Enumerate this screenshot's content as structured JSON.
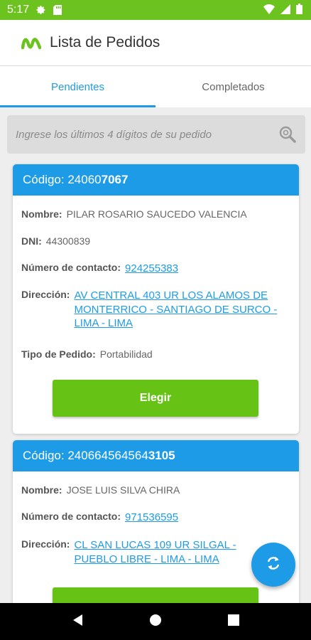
{
  "status_bar": {
    "time": "5:17"
  },
  "app_bar": {
    "title": "Lista de Pedidos"
  },
  "tabs": [
    {
      "label": "Pendientes"
    },
    {
      "label": "Completados"
    }
  ],
  "search": {
    "placeholder": "Ingrese los últimos 4 dígitos de su pedido"
  },
  "orders": [
    {
      "code_label": "Código:",
      "code_prefix": "24060",
      "code_suffix": "7067",
      "name_label": "Nombre:",
      "name": "PILAR ROSARIO SAUCEDO VALENCIA",
      "dni_label": "DNI:",
      "dni": "44300839",
      "contact_label": "Número de contacto:",
      "contact": "924255383",
      "address_label": "Dirección:",
      "address_lines": [
        "AV CENTRAL 403 UR LOS ALAMOS DE",
        "MONTERRICO - SANTIAGO DE SURCO -",
        "LIMA - LIMA"
      ],
      "type_label": "Tipo de Pedido:",
      "type": "Portabilidad",
      "button_label": "Elegir"
    },
    {
      "code_label": "Código:",
      "code_prefix": "240664564564",
      "code_suffix": "3105",
      "name_label": "Nombre:",
      "name": "JOSE LUIS SILVA CHIRA",
      "contact_label": "Número de contacto:",
      "contact": "971536595",
      "address_label": "Dirección:",
      "address_lines": [
        "CL SAN LUCAS 109 UR SILGAL -",
        "PUEBLO LIBRE - LIMA - LIMA"
      ]
    }
  ],
  "colors": {
    "status_bar": "#6cc21f",
    "accent_blue": "#1e9be6",
    "button_green": "#66c316"
  },
  "icons": {
    "refresh": "refresh-icon",
    "search": "search-zoom-icon"
  }
}
